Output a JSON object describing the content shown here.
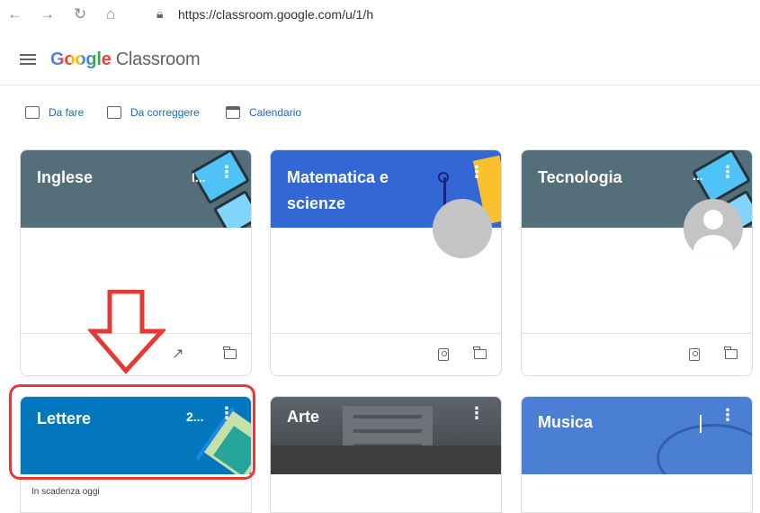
{
  "browser": {
    "url": "https://classroom.google.com/u/1/h",
    "icons": [
      "back-icon",
      "forward-icon",
      "reload-icon",
      "home-icon",
      "lock-icon"
    ]
  },
  "header": {
    "logo_google": "Google",
    "logo_product": "Classroom"
  },
  "toolbar": {
    "todo_label": "Da fare",
    "review_label": "Da correggere",
    "calendar_label": "Calendario"
  },
  "courses": [
    {
      "title": "Inglese",
      "banner_color": "#546e7a",
      "banner_text": "I..."
    },
    {
      "title": "Matematica e scienze",
      "banner_color": "#3367d6"
    },
    {
      "title": "Tecnologia",
      "banner_color": "#546e7a",
      "banner_text": "..."
    },
    {
      "title": "Lettere",
      "banner_color": "#0277bd",
      "banner_text": "2..."
    },
    {
      "title": "Arte",
      "banner_color": "#4a4f55"
    },
    {
      "title": "Musica",
      "banner_color": "#4a7fd4"
    }
  ],
  "lettere_due": "In scadenza oggi",
  "colors": {
    "accent": "#1967d2",
    "annotation": "#e53935"
  }
}
